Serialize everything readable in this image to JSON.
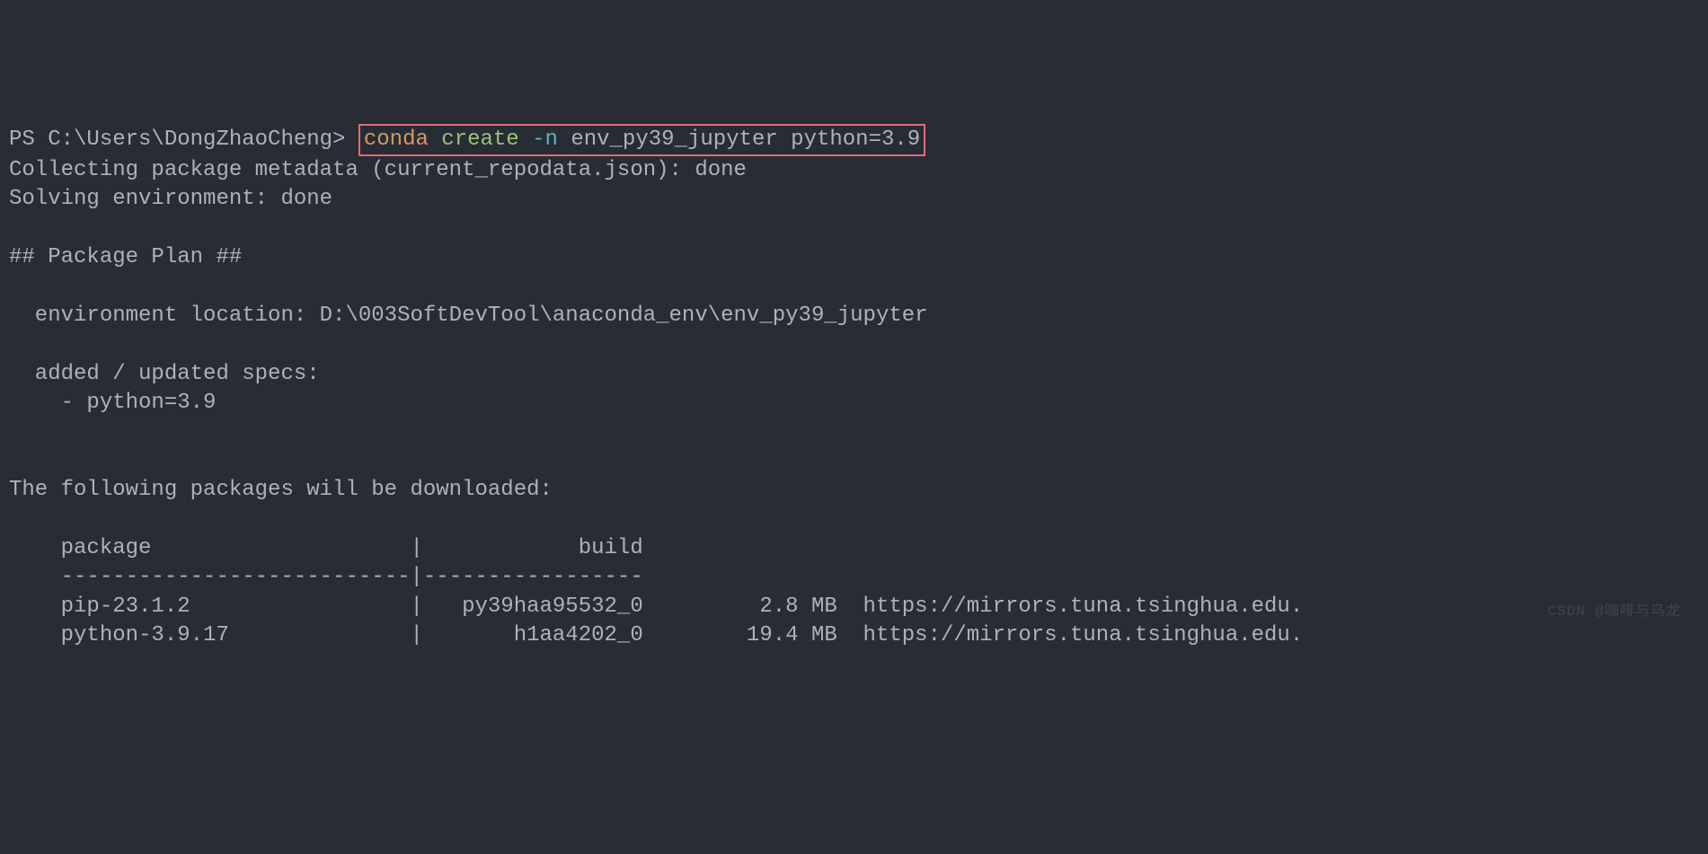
{
  "prompt": {
    "prefix": "PS C:\\Users\\DongZhaoCheng> ",
    "cmd_conda": "conda",
    "cmd_create": " create ",
    "cmd_flag": "-n",
    "cmd_args": " env_py39_jupyter python=3.9"
  },
  "output": {
    "line1": "Collecting package metadata (current_repodata.json): done",
    "line2": "Solving environment: done",
    "line3": "",
    "line4": "## Package Plan ##",
    "line5": "",
    "line6": "  environment location: D:\\003SoftDevTool\\anaconda_env\\env_py39_jupyter",
    "line7": "",
    "line8": "  added / updated specs:",
    "line9": "    - python=3.9",
    "line10": "",
    "line11": "",
    "line12": "The following packages will be downloaded:",
    "line13": "",
    "line14": "    package                    |            build",
    "line15": "    ---------------------------|-----------------",
    "line16": "    pip-23.1.2                 |   py39haa95532_0         2.8 MB  https://mirrors.tuna.tsinghua.edu.",
    "line17": "    python-3.9.17              |       h1aa4202_0        19.4 MB  https://mirrors.tuna.tsinghua.edu."
  },
  "watermark": "CSDN @咖啡与乌龙"
}
